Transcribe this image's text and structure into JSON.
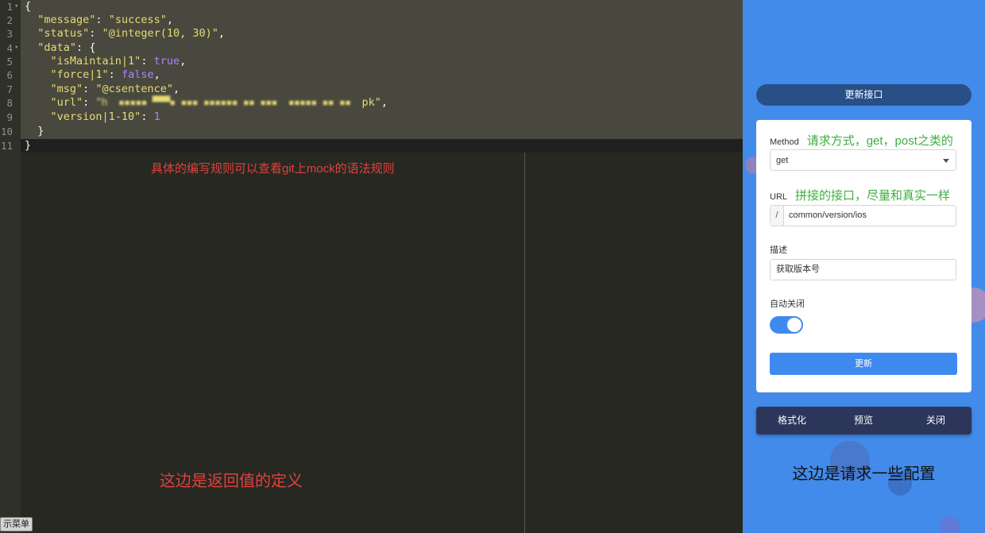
{
  "editor": {
    "line_numbers": [
      "1",
      "2",
      "3",
      "4",
      "5",
      "6",
      "7",
      "8",
      "9",
      "10",
      "11"
    ],
    "code": {
      "l1": "{",
      "l2_key": "\"message\"",
      "l2_val": "\"success\"",
      "l3_key": "\"status\"",
      "l3_val": "\"@integer(10, 30)\"",
      "l4_key": "\"data\"",
      "l4_open": "{",
      "l5_key": "\"isMaintain|1\"",
      "l5_val": "true",
      "l6_key": "\"force|1\"",
      "l6_val": "false",
      "l7_key": "\"msg\"",
      "l7_val": "\"@csentence\"",
      "l8_key": "\"url\"",
      "l8_val_blurred": "\"h  ▪▪▪▪▪ ▀▀▀▪ ▪▪▪ ▪▪▪▪▪▪ ▪▪ ▪▪▪  ▪▪▪▪▪ ▪▪ ▪▪  ",
      "l8_val_tail": "pk\"",
      "l9_key": "\"version|1-10\"",
      "l9_val": "1",
      "l10": "}",
      "l11": "}"
    },
    "annotation_rule": "具体的编写规则可以查看git上mock的语法规则",
    "annotation_return": "这边是返回值的定义",
    "menu_tab": "示菜单"
  },
  "panel": {
    "title": "更新接口",
    "method_label": "Method",
    "method_hint": "请求方式，get，post之类的",
    "method_value": "get",
    "url_label": "URL",
    "url_hint": "拼接的接口，尽量和真实一样",
    "url_prefix": "/",
    "url_value": "common/version/ios",
    "desc_label": "描述",
    "desc_value": "获取版本号",
    "autoclose_label": "自动关闭",
    "autoclose_on": true,
    "update_button": "更新",
    "actions": [
      "格式化",
      "预览",
      "关闭"
    ],
    "annotation": "这边是请求一些配置"
  },
  "colors": {
    "editor_bg": "#272822",
    "panel_bg": "#428bea",
    "title_pill": "#284f86",
    "primary": "#3f8af0",
    "action_bar": "#2c365b",
    "annotation_red": "#e0413c",
    "annotation_green": "#3fae3f"
  }
}
